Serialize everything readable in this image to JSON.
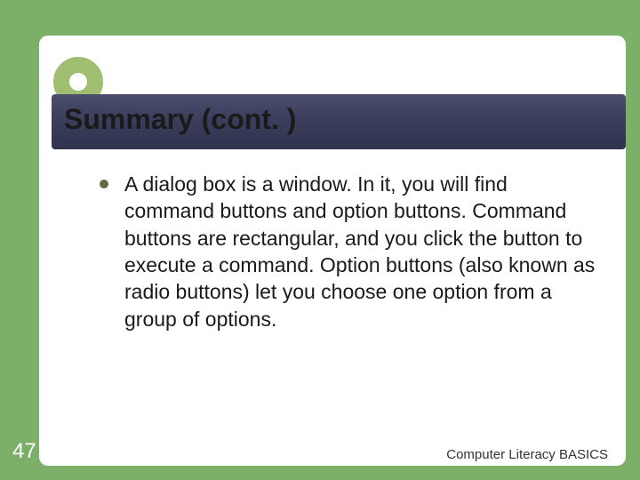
{
  "slide": {
    "title": "Summary (cont. )",
    "bullets": [
      "A dialog box is a window. In it, you will find command buttons and option buttons. Command buttons are rectangular, and you click the button to execute a command. Option buttons (also known as radio buttons) let you choose one option from a group of options."
    ],
    "page_number": "47",
    "footer": "Computer Literacy BASICS"
  }
}
